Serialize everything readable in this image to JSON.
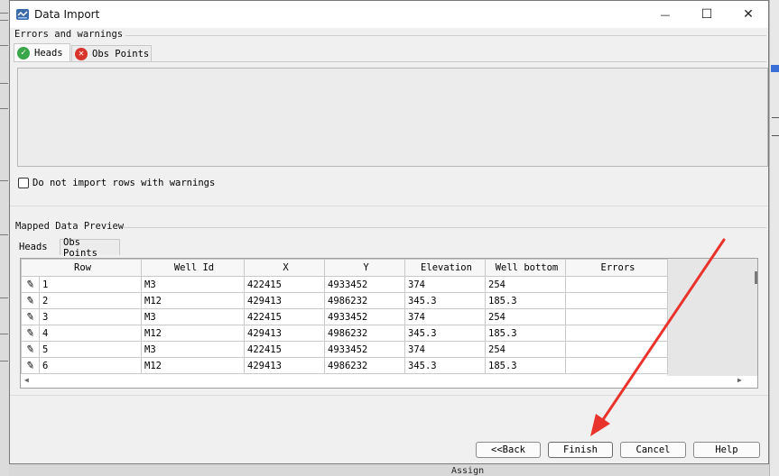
{
  "window": {
    "title": "Data Import",
    "minimize_glyph": "—",
    "maximize_glyph": "☐",
    "close_glyph": "✕"
  },
  "errors_section": {
    "label": "Errors and warnings",
    "tabs": [
      {
        "label": "Heads",
        "icon": "check-icon",
        "active": true
      },
      {
        "label": "Obs Points",
        "icon": "error-icon",
        "active": false
      }
    ],
    "checkbox_label": "Do not import rows with warnings",
    "checkbox_checked": false
  },
  "preview_section": {
    "label": "Mapped Data Preview",
    "tabs": [
      {
        "label": "Heads",
        "active": true
      },
      {
        "label": "Obs Points",
        "active": false
      }
    ],
    "columns": [
      "Row",
      "Well Id",
      "X",
      "Y",
      "Elevation",
      "Well bottom",
      "Errors"
    ],
    "rows": [
      [
        "1",
        "M3",
        "422415",
        "4933452",
        "374",
        "254",
        ""
      ],
      [
        "2",
        "M12",
        "429413",
        "4986232",
        "345.3",
        "185.3",
        ""
      ],
      [
        "3",
        "M3",
        "422415",
        "4933452",
        "374",
        "254",
        ""
      ],
      [
        "4",
        "M12",
        "429413",
        "4986232",
        "345.3",
        "185.3",
        ""
      ],
      [
        "5",
        "M3",
        "422415",
        "4933452",
        "374",
        "254",
        ""
      ],
      [
        "6",
        "M12",
        "429413",
        "4986232",
        "345.3",
        "185.3",
        ""
      ]
    ]
  },
  "buttons": {
    "back": "<<Back",
    "finish": "Finish",
    "cancel": "Cancel",
    "help": "Help"
  },
  "background": {
    "assign_label": "Assign"
  },
  "colors": {
    "annotation_arrow": "#e8342c",
    "check_green": "#3aa64a",
    "error_red": "#d9342b"
  }
}
